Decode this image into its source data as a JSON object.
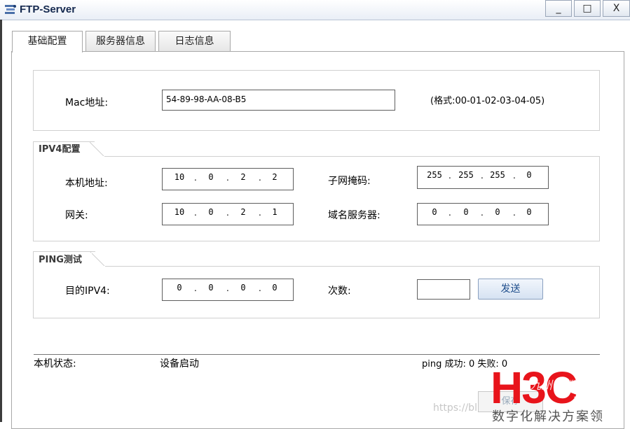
{
  "window": {
    "title": "FTP-Server",
    "controls": {
      "minimize": "_",
      "maximize": "□",
      "close": "X"
    }
  },
  "tabs": [
    {
      "label": "基础配置",
      "active": true
    },
    {
      "label": "服务器信息",
      "active": false
    },
    {
      "label": "日志信息",
      "active": false
    }
  ],
  "mac": {
    "label": "Mac地址:",
    "value": "54-89-98-AA-08-B5",
    "hint": "(格式:00-01-02-03-04-05)"
  },
  "ipv4": {
    "title": "IPV4配置",
    "local_label": "本机地址:",
    "local": [
      "10",
      "0",
      "2",
      "2"
    ],
    "mask_label": "子网掩码:",
    "mask": [
      "255",
      "255",
      "255",
      "0"
    ],
    "gateway_label": "网关:",
    "gateway": [
      "10",
      "0",
      "2",
      "1"
    ],
    "dns_label": "域名服务器:",
    "dns": [
      "0",
      "0",
      "0",
      "0"
    ]
  },
  "ping": {
    "title": "PING测试",
    "dest_label": "目的IPV4:",
    "dest": [
      "0",
      "0",
      "0",
      "0"
    ],
    "count_label": "次数:",
    "count": "",
    "send_label": "发送"
  },
  "status": {
    "label": "本机状态:",
    "value": "设备启动",
    "ping_result": "ping 成功: 0 失败: 0"
  },
  "save_label": "保存",
  "watermark": {
    "url": "https://bl",
    "logo_text": "H3C",
    "logo_overlay": "九州云腾",
    "logo_overlay_sub": ".com",
    "slogan": "数字化解决方案领"
  },
  "colors": {
    "logo_red": "#e8141b",
    "accent_blue": "#1f4e8c"
  }
}
